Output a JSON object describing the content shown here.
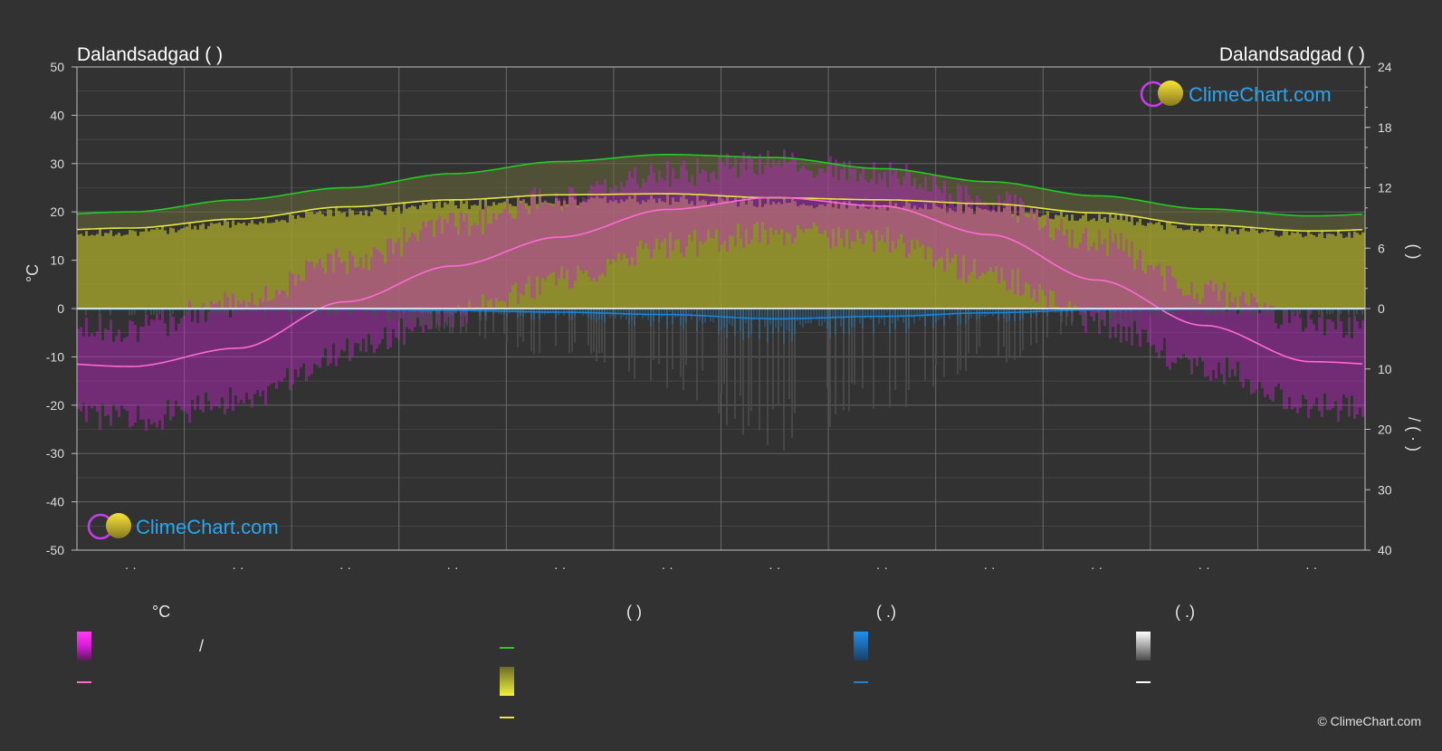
{
  "chart_data": {
    "type": "area",
    "title_left": "Dalandsadgad (            )",
    "title_right": "Dalandsadgad (            )",
    "ylabel_left": "°C",
    "ylabel_right_top": "(     )",
    "ylabel_right_bottom": "/     (  ·  )",
    "ylim_left": [
      -50,
      50
    ],
    "yticks_left": [
      50,
      40,
      30,
      20,
      10,
      0,
      -10,
      -20,
      -30,
      -40,
      -50
    ],
    "yticks_right_top": [
      24,
      18,
      12,
      6,
      0
    ],
    "yticks_right_bottom": [
      10,
      20,
      30,
      40
    ],
    "month_labels": [
      "· ·",
      "· ·",
      "· ·",
      "· ·",
      "· ·",
      "· ·",
      "· ·",
      "· ·",
      "· ·",
      "· ·",
      "· ·",
      "· ·"
    ],
    "grid": true,
    "months": [
      1,
      2,
      3,
      4,
      5,
      6,
      7,
      8,
      9,
      10,
      11,
      12
    ],
    "series": [
      {
        "key": "daylight",
        "color": "#22cc22",
        "values": [
          9.6,
          10.8,
          12.0,
          13.4,
          14.6,
          15.3,
          15.0,
          13.9,
          12.6,
          11.2,
          9.9,
          9.2
        ]
      },
      {
        "key": "sunshine",
        "color": "#e8e840",
        "values": [
          8.0,
          8.9,
          10.1,
          10.8,
          11.3,
          11.4,
          11.0,
          10.8,
          10.4,
          9.5,
          8.3,
          7.7
        ]
      },
      {
        "key": "mean_temp",
        "color": "#ff6ad5",
        "values": [
          -12.0,
          -8.2,
          1.4,
          8.8,
          14.8,
          20.5,
          23.0,
          21.2,
          15.3,
          5.9,
          -3.5,
          -11.0
        ]
      },
      {
        "key": "precip_mm",
        "color": "#1a86d6",
        "values": [
          0.1,
          0.1,
          0.1,
          0.3,
          0.6,
          1.0,
          1.7,
          1.3,
          0.7,
          0.2,
          0.1,
          0.1
        ]
      }
    ],
    "temp_range": {
      "max": [
        -4,
        1,
        10,
        17,
        23,
        28,
        30,
        28,
        22,
        14,
        3,
        -3
      ],
      "min": [
        -23,
        -19,
        -9,
        -1,
        6,
        13,
        16,
        14,
        7,
        -3,
        -12,
        -20
      ]
    }
  },
  "legend": {
    "col1_header": "°C",
    "col1_row1": "/",
    "col2_header": "(          )",
    "col3_header": "(    .)",
    "col4_header": "(    .)"
  },
  "brand": {
    "text": "ClimeChart.com"
  },
  "copyright": "© ClimeChart.com",
  "colors": {
    "background": "#323232",
    "grid": "#6a6a6a",
    "axis": "#bfbfbf",
    "daylight": "#22cc22",
    "sunshine": "#e8e840",
    "temp": "#ff6ad5",
    "temp_range": "#c025c9",
    "precip": "#1a86d6",
    "snow": "#cfcfcf"
  }
}
